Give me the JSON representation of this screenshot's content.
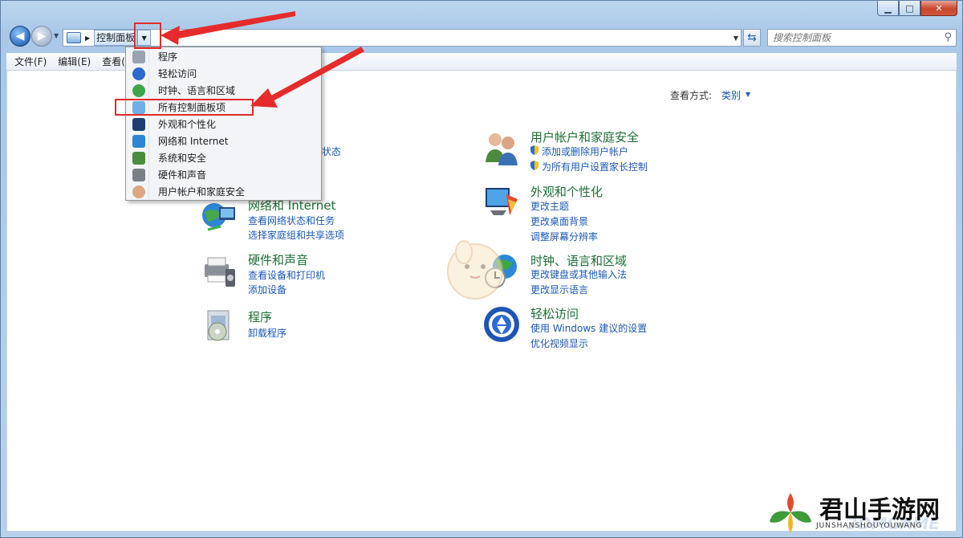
{
  "window": {
    "buttons": {
      "minimize": "▁",
      "maximize": "□",
      "close": "✕"
    }
  },
  "address": {
    "crumb": "控制面板",
    "search_placeholder": "搜索控制面板"
  },
  "menu": [
    "文件(F)",
    "编辑(E)",
    "查看("
  ],
  "view": {
    "label": "查看方式:",
    "value": "类别"
  },
  "dropdown": [
    "程序",
    "轻松访问",
    "时钟、语言和区域",
    "所有控制面板项",
    "外观和个性化",
    "网络和 Internet",
    "系统和安全",
    "硬件和声音",
    "用户帐户和家庭安全"
  ],
  "partial_link": "状态",
  "categories": {
    "network": {
      "title": "网络和 Internet",
      "links": [
        "查看网络状态和任务",
        "选择家庭组和共享选项"
      ]
    },
    "hardware": {
      "title": "硬件和声音",
      "links": [
        "查看设备和打印机",
        "添加设备"
      ]
    },
    "programs": {
      "title": "程序",
      "links": [
        "卸载程序"
      ]
    },
    "user": {
      "title": "用户帐户和家庭安全",
      "links": [
        "添加或删除用户帐户",
        "为所有用户设置家长控制"
      ]
    },
    "appearance": {
      "title": "外观和个性化",
      "links": [
        "更改主题",
        "更改桌面背景",
        "调整屏幕分辨率"
      ]
    },
    "clock": {
      "title": "时钟、语言和区域",
      "links": [
        "更改键盘或其他输入法",
        "更改显示语言"
      ]
    },
    "ease": {
      "title": "轻松访问",
      "links": [
        "使用 Windows 建议的设置",
        "优化视频显示"
      ]
    }
  },
  "watermark": {
    "text": "君山手游网",
    "sub": "JUNSHANSHOUYOUWANG",
    "logo": "3DMGAME"
  },
  "colors": {
    "accent": "#1b58b8",
    "category": "#1d6f36",
    "annotation": "#e52b2b"
  }
}
